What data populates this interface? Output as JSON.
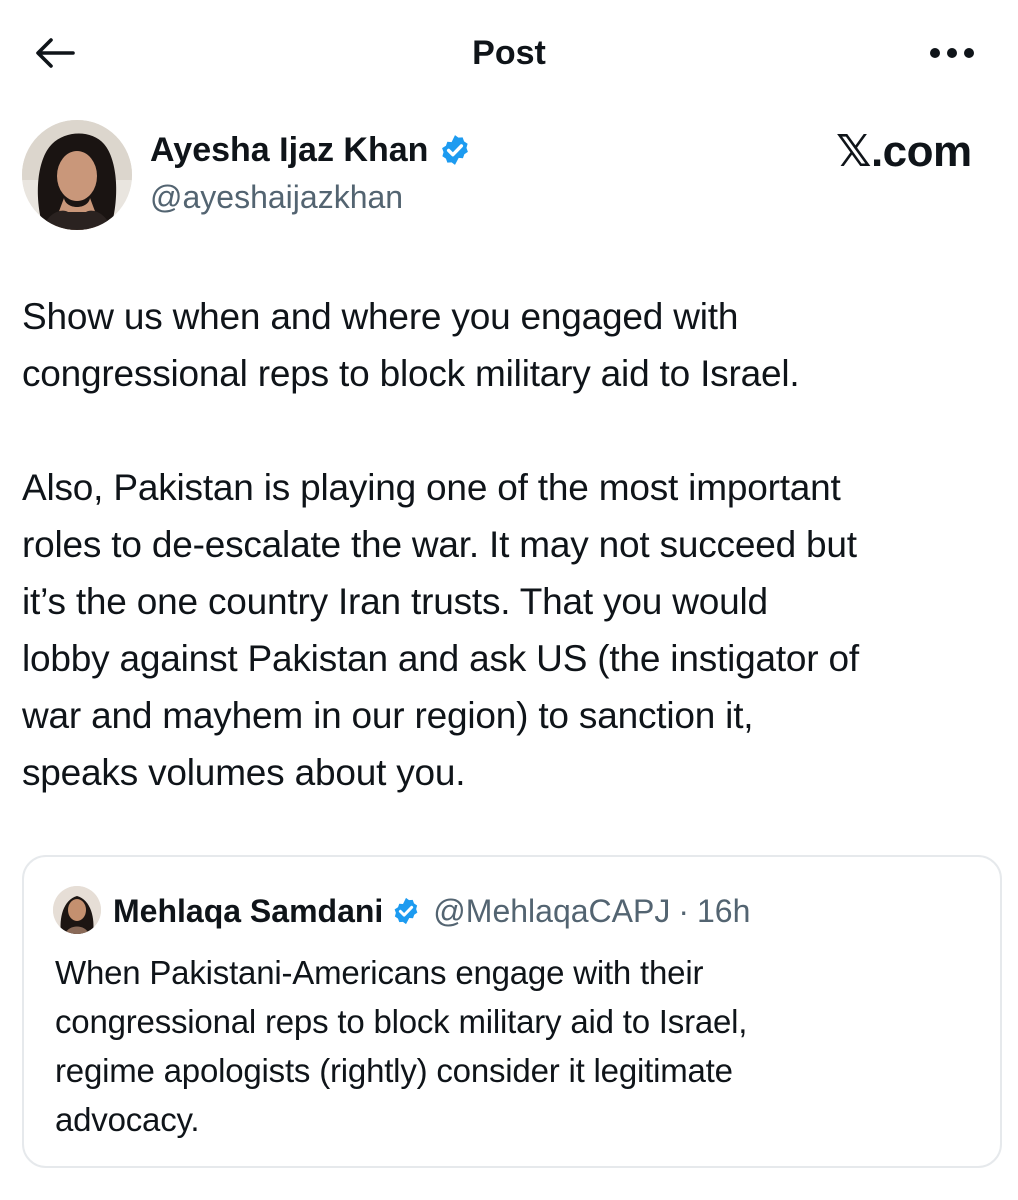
{
  "header": {
    "title": "Post",
    "back_icon": "arrow-left-icon",
    "more_icon": "more-horizontal-icon"
  },
  "author": {
    "name": "Ayesha Ijaz Khan",
    "handle": "@ayeshaijazkhan",
    "verified_icon": "verified-badge-icon"
  },
  "brand": {
    "logo_text": "𝕏.com"
  },
  "tweet": {
    "paragraph_1_lines": [
      "Show us when and where you engaged with",
      "congressional reps to block military aid to Israel."
    ],
    "paragraph_2_lines": [
      "Also, Pakistan is playing one of the most important",
      "roles to de-escalate the war. It may not succeed but",
      "it’s the one country Iran trusts. That you would",
      "lobby against Pakistan and ask US (the instigator of",
      "war and mayhem in our region) to sanction it,",
      "speaks volumes about you."
    ]
  },
  "quote": {
    "name": "Mehlaqa Samdani",
    "handle": "@MehlaqaCAPJ",
    "separator": "·",
    "time": "16h",
    "text_lines": [
      "When Pakistani-Americans engage with their",
      "congressional reps to block military aid to Israel,",
      "regime apologists (rightly) consider it legitimate",
      "advocacy."
    ]
  },
  "colors": {
    "text_primary": "#0f1419",
    "text_secondary": "#536471",
    "verified_blue": "#1d9bf0",
    "card_border": "#e6e9ec"
  }
}
